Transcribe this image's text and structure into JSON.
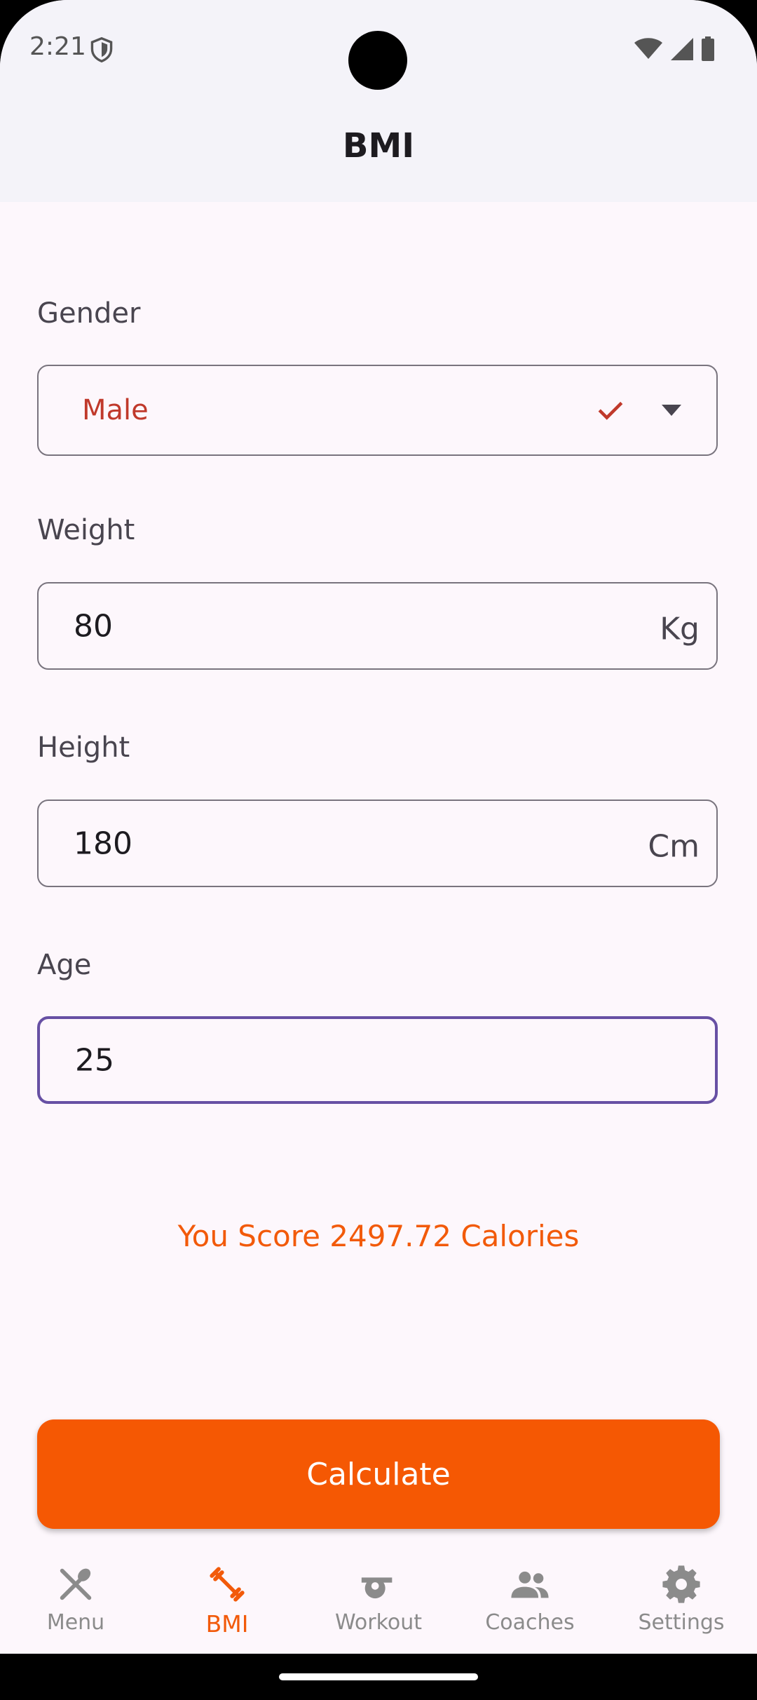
{
  "status_bar": {
    "time": "2:21"
  },
  "app_bar": {
    "title": "BMI"
  },
  "form": {
    "gender": {
      "label": "Gender",
      "value": "Male"
    },
    "weight": {
      "label": "Weight",
      "value": "80",
      "unit": "Kg"
    },
    "height": {
      "label": "Height",
      "value": "180",
      "unit": "Cm"
    },
    "age": {
      "label": "Age",
      "value": "25"
    }
  },
  "result": {
    "text": "You Score 2497.72 Calories"
  },
  "actions": {
    "calculate_label": "Calculate"
  },
  "bottom_nav": {
    "items": [
      {
        "label": "Menu",
        "icon": "utensils-icon",
        "active": false
      },
      {
        "label": "BMI",
        "icon": "dumbbell-icon",
        "active": true
      },
      {
        "label": "Workout",
        "icon": "whistle-icon",
        "active": false
      },
      {
        "label": "Coaches",
        "icon": "people-icon",
        "active": false
      },
      {
        "label": "Settings",
        "icon": "gear-icon",
        "active": false
      }
    ]
  },
  "colors": {
    "accent": "#f55803",
    "focus_border": "#6750a4",
    "gender_value": "#c0392b"
  }
}
